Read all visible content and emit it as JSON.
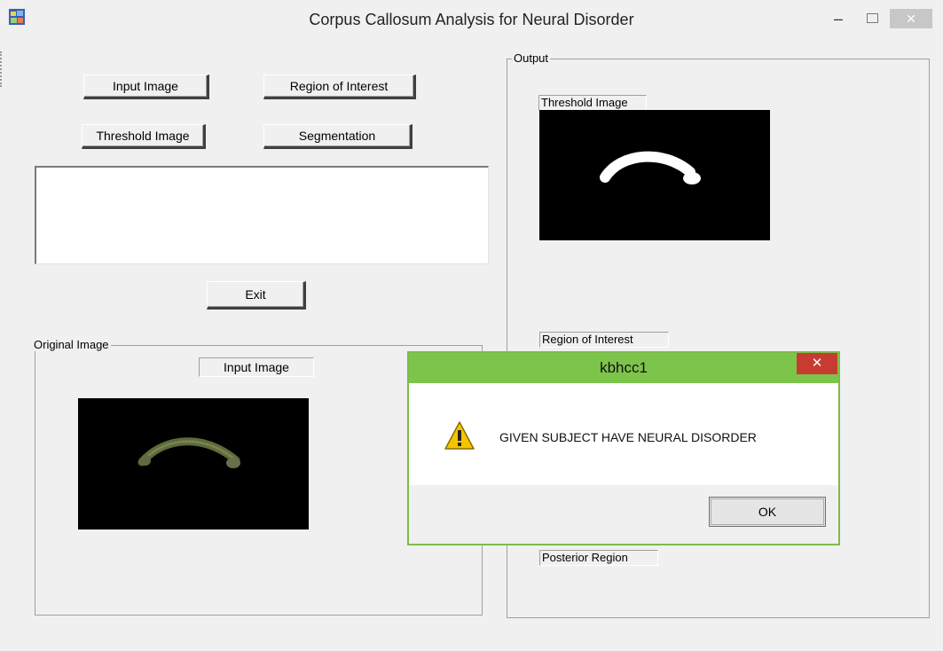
{
  "window": {
    "title": "Corpus Callosum Analysis for Neural Disorder",
    "minimize_glyph": "–",
    "close_glyph": "✕"
  },
  "buttons": {
    "input_image": "Input Image",
    "region_of_interest": "Region of Interest",
    "threshold_image": "Threshold Image",
    "segmentation": "Segmentation",
    "exit": "Exit"
  },
  "original_group": {
    "label": "Original Image",
    "image_label": "Input Image"
  },
  "output_group": {
    "label": "Output",
    "threshold_label": "Threshold Image",
    "roi_label": "Region of Interest",
    "posterior_label": "Posterior Region"
  },
  "dialog": {
    "title": "kbhcc1",
    "message": "GIVEN SUBJECT HAVE NEURAL DISORDER",
    "ok_label": "OK",
    "close_glyph": "✕",
    "icon": "warning-icon"
  },
  "colors": {
    "dialog_border": "#7dc44b",
    "dialog_close": "#c73b31",
    "warning_yellow": "#f5c400"
  }
}
